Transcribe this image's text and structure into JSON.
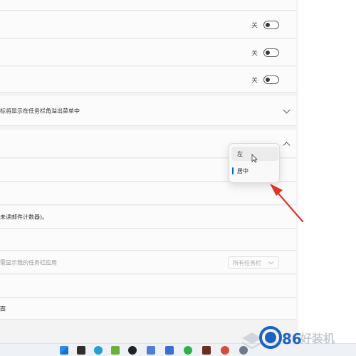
{
  "toggles": [
    {
      "state_label": "关",
      "on": false
    },
    {
      "state_label": "关",
      "on": false
    },
    {
      "state_label": "关",
      "on": false
    }
  ],
  "rows": {
    "corner_overflow_desc": "标将显示在任务栏角溢出菜单中",
    "badges_desc": "未读邮件计数器)。",
    "multi_display_desc": "需显示我的任务栏应用",
    "multi_display_select": "所有任务栏",
    "last_desc": "面"
  },
  "alignment_dropdown": {
    "options": [
      "左",
      "居中"
    ],
    "selected": "居中",
    "hovered": "左"
  },
  "colors": {
    "accent": "#0067c0",
    "arrow": "#e0322b",
    "card_bg": "#fbfbfb",
    "page_bg": "#f3f3f3"
  },
  "watermark": {
    "text": "好装机"
  }
}
